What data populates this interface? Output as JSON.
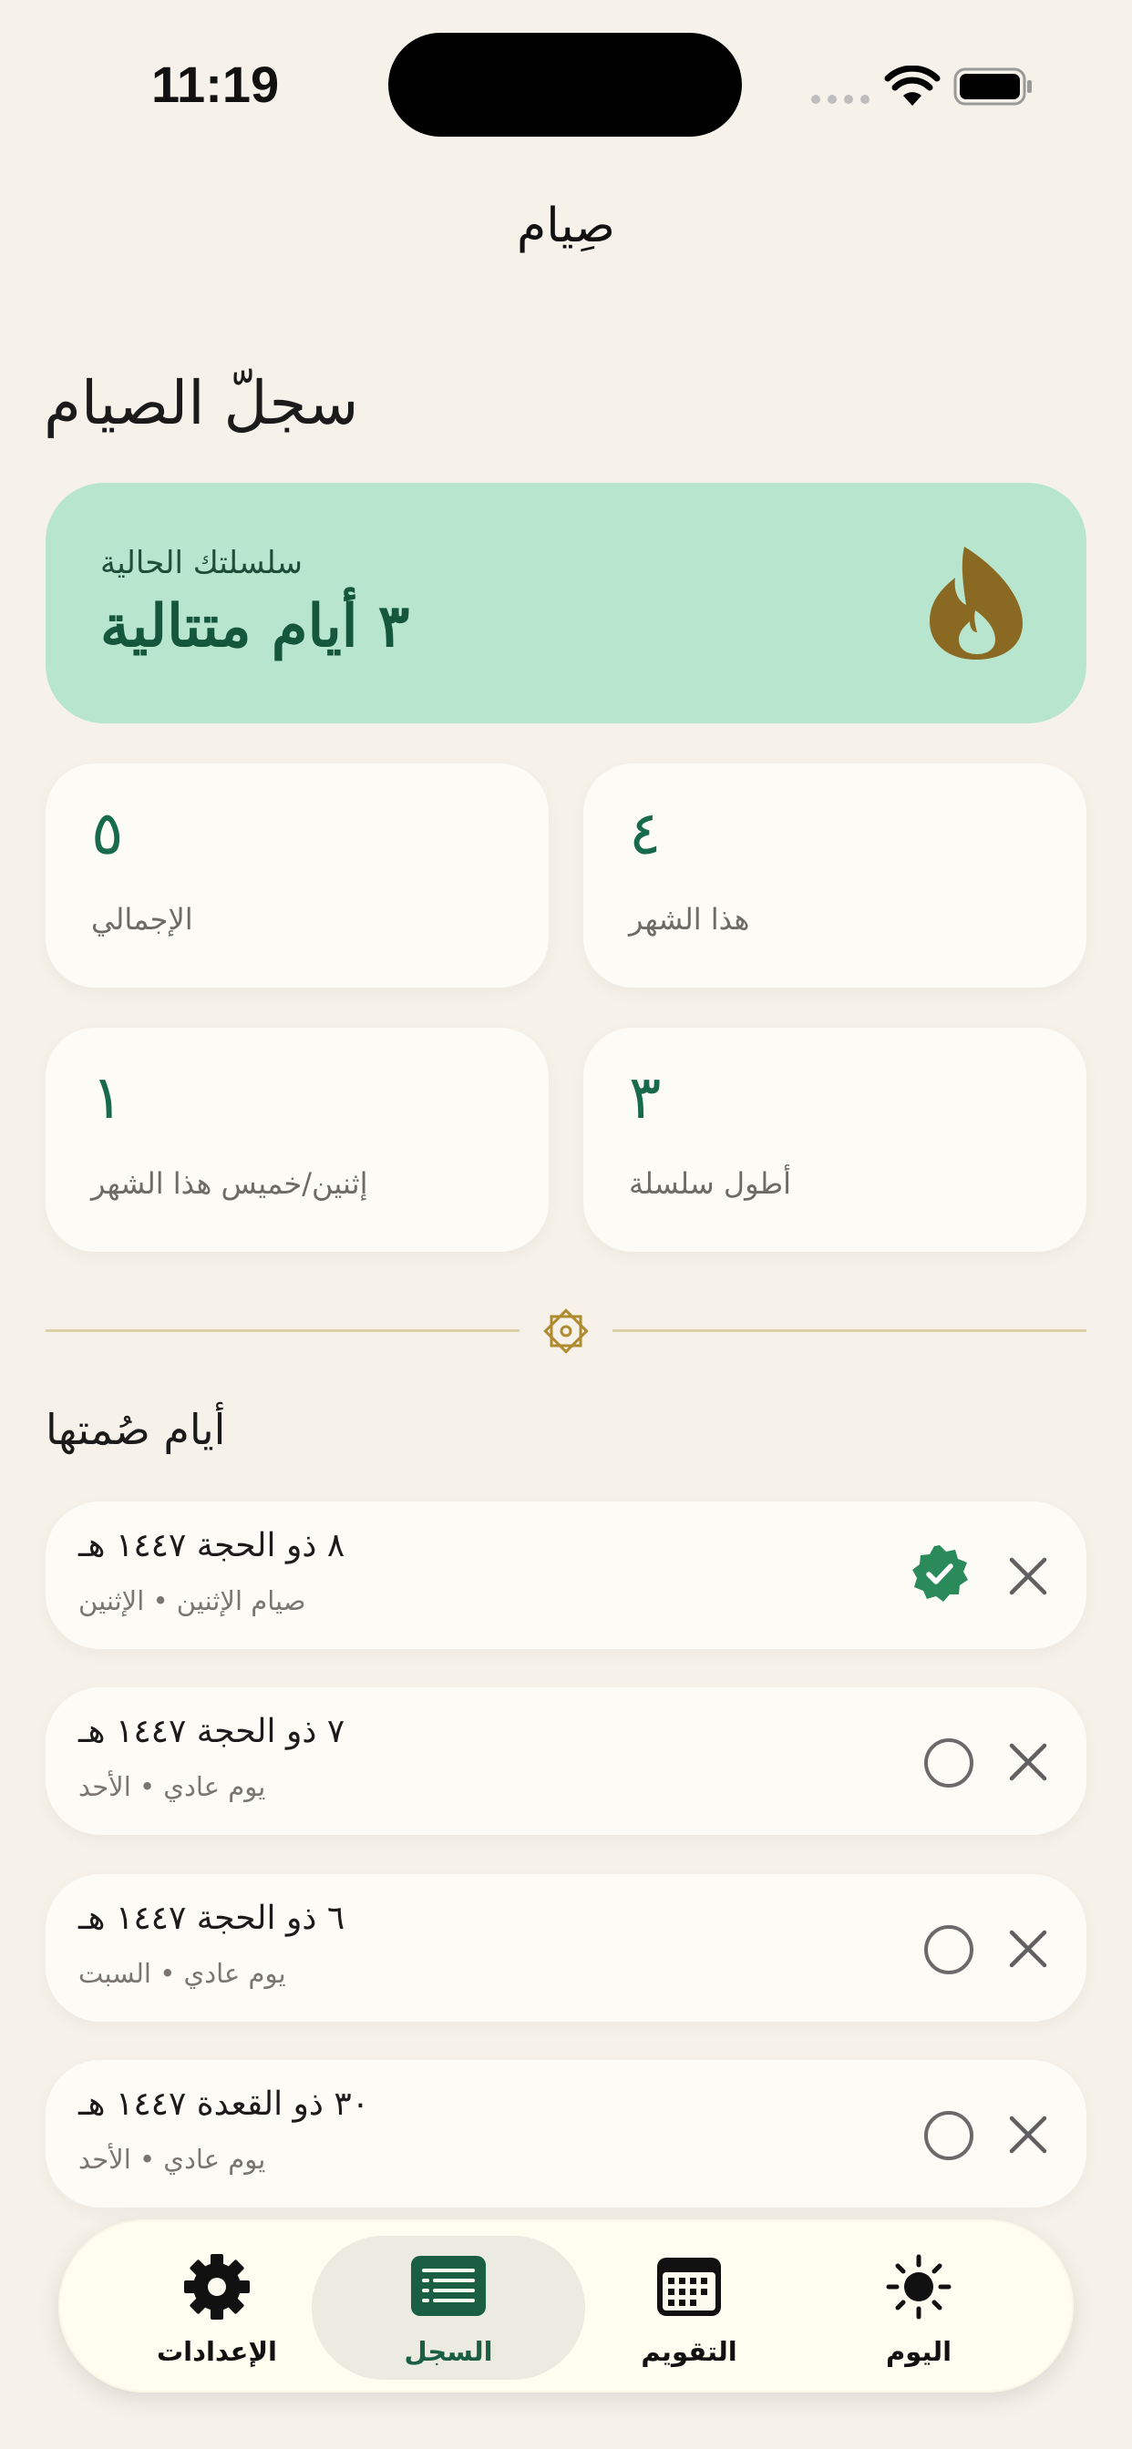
{
  "status_bar": {
    "time": "11:19",
    "icons": [
      "cellular-signal-icon",
      "wifi-icon",
      "battery-icon"
    ]
  },
  "nav": {
    "title": "صِيام"
  },
  "page": {
    "heading": "سجلّ الصيام"
  },
  "streak": {
    "label": "سلسلتك الحالية",
    "value": "٣ أيام متتالية",
    "icon": "flame-icon",
    "card_color": "#b8e5cd",
    "icon_color": "#8a6a22"
  },
  "stats": [
    {
      "value": "٤",
      "label": "هذا الشهر"
    },
    {
      "value": "٥",
      "label": "الإجمالي"
    },
    {
      "value": "٣",
      "label": "أطول سلسلة"
    },
    {
      "value": "١",
      "label": "إثنين/خميس هذا الشهر"
    }
  ],
  "section": {
    "title": "أيام صُمتها"
  },
  "logs": [
    {
      "date": "٨ ذو الحجة ١٤٤٧ هـ",
      "subtitle": "صيام الإثنين • الإثنين",
      "fasted": true
    },
    {
      "date": "٧ ذو الحجة ١٤٤٧ هـ",
      "subtitle": "يوم عادي • الأحد",
      "fasted": false
    },
    {
      "date": "٦ ذو الحجة ١٤٤٧ هـ",
      "subtitle": "يوم عادي • السبت",
      "fasted": false
    },
    {
      "date": "٣٠ ذو القعدة ١٤٤٧ هـ",
      "subtitle": "يوم عادي • الأحد",
      "fasted": false
    }
  ],
  "tab_bar": {
    "tabs": [
      {
        "label": "اليوم",
        "icon": "sun-icon",
        "active": false
      },
      {
        "label": "التقويم",
        "icon": "calendar-icon",
        "active": false
      },
      {
        "label": "السجل",
        "icon": "log-list-icon",
        "active": true
      },
      {
        "label": "الإعدادات",
        "icon": "gear-icon",
        "active": false
      }
    ]
  },
  "colors": {
    "background": "#f6f2ea",
    "accent_green": "#176a4b",
    "check_green": "#2a8a5a",
    "divider_gold": "#dccfa7"
  }
}
